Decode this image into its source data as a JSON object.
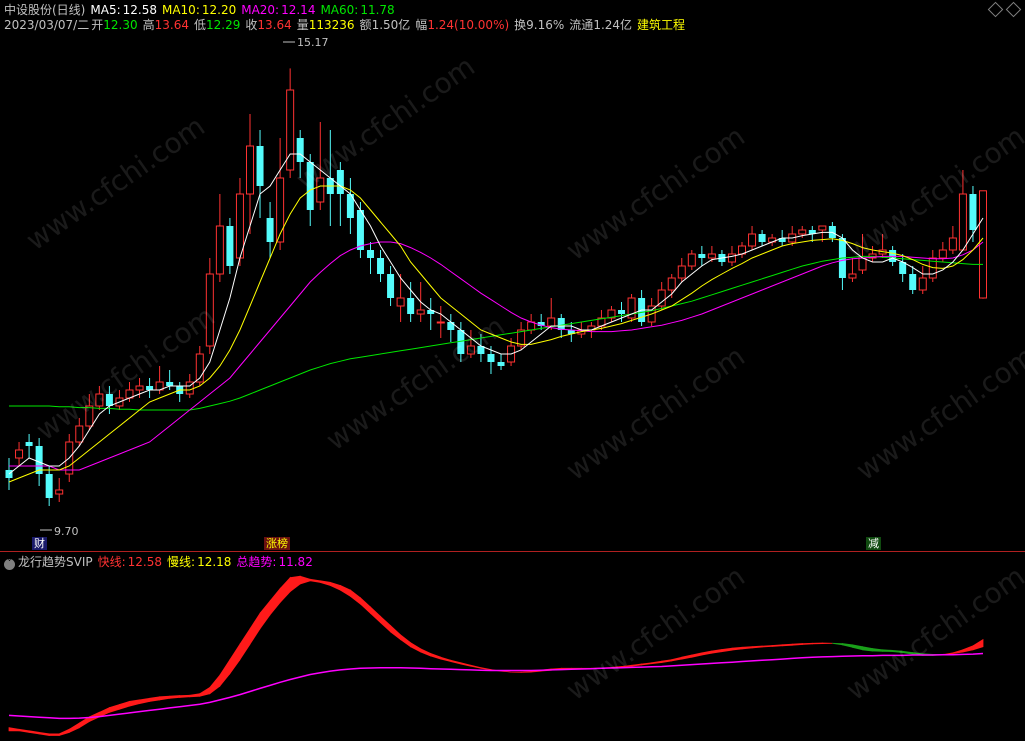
{
  "header": {
    "title": "中设股份(日线)",
    "ma5_label": "MA5:",
    "ma5": "12.58",
    "ma10_label": "MA10:",
    "ma10": "12.20",
    "ma20_label": "MA20:",
    "ma20": "12.14",
    "ma60_label": "MA60:",
    "ma60": "11.78",
    "date": "2023/03/07/二",
    "open_label": "开",
    "open": "12.30",
    "high_label": "高",
    "high": "13.64",
    "low_label": "低",
    "low": "12.29",
    "close_label": "收",
    "close": "13.64",
    "vol_label": "量",
    "vol": "113236",
    "amount_label": "额",
    "amount": "1.50亿",
    "change_label": "幅",
    "change": "1.24(10.00%)",
    "turnover_label": "换",
    "turnover": "9.16%",
    "float_label": "流通",
    "float": "1.24亿",
    "sector": "建筑工程"
  },
  "markers": {
    "high": "15.17",
    "low": "9.70",
    "tag_cai": "财",
    "tag_zhangbang": "涨榜",
    "tag_jian": "减"
  },
  "indicator": {
    "name": "龙行趋势SVIP",
    "fast_label": "快线:",
    "fast": "12.58",
    "slow_label": "慢线:",
    "slow": "12.18",
    "total_label": "总趋势:",
    "total": "11.82"
  },
  "watermark": "www.cfchi.com",
  "colors": {
    "up": "#ff3232",
    "down": "#54fcfc",
    "ma5": "#ffffff",
    "ma10": "#ffff00",
    "ma20": "#ff00ff",
    "ma60": "#00e600",
    "frame": "#b02020"
  },
  "chart_data": {
    "type": "candlestick",
    "ylim": [
      9.4,
      15.5
    ],
    "candles": [
      {
        "o": 10.15,
        "c": 10.05,
        "h": 10.3,
        "l": 9.9
      },
      {
        "o": 10.3,
        "c": 10.4,
        "h": 10.5,
        "l": 10.2
      },
      {
        "o": 10.5,
        "c": 10.45,
        "h": 10.6,
        "l": 10.3
      },
      {
        "o": 10.45,
        "c": 10.1,
        "h": 10.55,
        "l": 9.95
      },
      {
        "o": 10.1,
        "c": 9.8,
        "h": 10.2,
        "l": 9.7
      },
      {
        "o": 9.85,
        "c": 9.9,
        "h": 10.05,
        "l": 9.75
      },
      {
        "o": 10.1,
        "c": 10.5,
        "h": 10.6,
        "l": 10.0
      },
      {
        "o": 10.5,
        "c": 10.7,
        "h": 10.8,
        "l": 10.45
      },
      {
        "o": 10.7,
        "c": 10.95,
        "h": 11.1,
        "l": 10.65
      },
      {
        "o": 10.95,
        "c": 11.1,
        "h": 11.2,
        "l": 10.9
      },
      {
        "o": 11.1,
        "c": 10.95,
        "h": 11.2,
        "l": 10.85
      },
      {
        "o": 10.95,
        "c": 11.05,
        "h": 11.15,
        "l": 10.9
      },
      {
        "o": 11.05,
        "c": 11.15,
        "h": 11.25,
        "l": 11.0
      },
      {
        "o": 11.15,
        "c": 11.2,
        "h": 11.3,
        "l": 11.05
      },
      {
        "o": 11.2,
        "c": 11.15,
        "h": 11.3,
        "l": 11.05
      },
      {
        "o": 11.15,
        "c": 11.25,
        "h": 11.45,
        "l": 11.1
      },
      {
        "o": 11.25,
        "c": 11.2,
        "h": 11.4,
        "l": 11.15
      },
      {
        "o": 11.2,
        "c": 11.1,
        "h": 11.25,
        "l": 11.0
      },
      {
        "o": 11.1,
        "c": 11.25,
        "h": 11.35,
        "l": 11.05
      },
      {
        "o": 11.25,
        "c": 11.6,
        "h": 11.7,
        "l": 11.2
      },
      {
        "o": 11.7,
        "c": 12.6,
        "h": 12.8,
        "l": 11.6
      },
      {
        "o": 12.6,
        "c": 13.2,
        "h": 13.6,
        "l": 12.5
      },
      {
        "o": 13.2,
        "c": 12.7,
        "h": 13.3,
        "l": 12.6
      },
      {
        "o": 12.8,
        "c": 13.6,
        "h": 13.8,
        "l": 12.7
      },
      {
        "o": 13.6,
        "c": 14.2,
        "h": 14.6,
        "l": 13.1
      },
      {
        "o": 14.2,
        "c": 13.7,
        "h": 14.4,
        "l": 13.3
      },
      {
        "o": 13.3,
        "c": 13.0,
        "h": 13.5,
        "l": 12.8
      },
      {
        "o": 13.0,
        "c": 13.8,
        "h": 14.3,
        "l": 12.9
      },
      {
        "o": 13.9,
        "c": 14.9,
        "h": 15.17,
        "l": 13.8
      },
      {
        "o": 14.3,
        "c": 14.0,
        "h": 14.4,
        "l": 13.8
      },
      {
        "o": 14.0,
        "c": 13.4,
        "h": 14.1,
        "l": 13.2
      },
      {
        "o": 13.5,
        "c": 13.8,
        "h": 14.5,
        "l": 13.4
      },
      {
        "o": 13.8,
        "c": 13.6,
        "h": 14.4,
        "l": 13.2
      },
      {
        "o": 13.9,
        "c": 13.6,
        "h": 14.0,
        "l": 13.2
      },
      {
        "o": 13.6,
        "c": 13.3,
        "h": 13.8,
        "l": 13.1
      },
      {
        "o": 13.4,
        "c": 12.9,
        "h": 13.5,
        "l": 12.8
      },
      {
        "o": 12.9,
        "c": 12.8,
        "h": 13.0,
        "l": 12.6
      },
      {
        "o": 12.8,
        "c": 12.6,
        "h": 12.9,
        "l": 12.5
      },
      {
        "o": 12.6,
        "c": 12.3,
        "h": 12.7,
        "l": 12.2
      },
      {
        "o": 12.2,
        "c": 12.3,
        "h": 12.6,
        "l": 12.0
      },
      {
        "o": 12.3,
        "c": 12.1,
        "h": 12.5,
        "l": 12.0
      },
      {
        "o": 12.1,
        "c": 12.15,
        "h": 12.5,
        "l": 12.0
      },
      {
        "o": 12.15,
        "c": 12.1,
        "h": 12.3,
        "l": 11.9
      },
      {
        "o": 12.0,
        "c": 12.0,
        "h": 12.2,
        "l": 11.8
      },
      {
        "o": 12.0,
        "c": 11.9,
        "h": 12.1,
        "l": 11.75
      },
      {
        "o": 11.9,
        "c": 11.6,
        "h": 12.0,
        "l": 11.5
      },
      {
        "o": 11.6,
        "c": 11.7,
        "h": 11.9,
        "l": 11.55
      },
      {
        "o": 11.7,
        "c": 11.6,
        "h": 11.85,
        "l": 11.5
      },
      {
        "o": 11.6,
        "c": 11.5,
        "h": 11.7,
        "l": 11.35
      },
      {
        "o": 11.5,
        "c": 11.45,
        "h": 11.6,
        "l": 11.4
      },
      {
        "o": 11.5,
        "c": 11.7,
        "h": 11.8,
        "l": 11.45
      },
      {
        "o": 11.7,
        "c": 11.9,
        "h": 12.0,
        "l": 11.65
      },
      {
        "o": 11.9,
        "c": 12.0,
        "h": 12.1,
        "l": 11.85
      },
      {
        "o": 12.0,
        "c": 11.95,
        "h": 12.1,
        "l": 11.9
      },
      {
        "o": 11.95,
        "c": 12.05,
        "h": 12.3,
        "l": 11.9
      },
      {
        "o": 12.05,
        "c": 11.9,
        "h": 12.1,
        "l": 11.8
      },
      {
        "o": 11.9,
        "c": 11.85,
        "h": 12.0,
        "l": 11.75
      },
      {
        "o": 11.85,
        "c": 11.9,
        "h": 12.0,
        "l": 11.8
      },
      {
        "o": 11.9,
        "c": 11.95,
        "h": 12.0,
        "l": 11.8
      },
      {
        "o": 11.95,
        "c": 12.05,
        "h": 12.15,
        "l": 11.9
      },
      {
        "o": 12.05,
        "c": 12.15,
        "h": 12.2,
        "l": 12.0
      },
      {
        "o": 12.15,
        "c": 12.1,
        "h": 12.25,
        "l": 12.0
      },
      {
        "o": 12.05,
        "c": 12.3,
        "h": 12.35,
        "l": 12.0
      },
      {
        "o": 12.3,
        "c": 12.0,
        "h": 12.4,
        "l": 11.95
      },
      {
        "o": 12.0,
        "c": 12.2,
        "h": 12.3,
        "l": 11.95
      },
      {
        "o": 12.2,
        "c": 12.4,
        "h": 12.5,
        "l": 12.15
      },
      {
        "o": 12.4,
        "c": 12.55,
        "h": 12.6,
        "l": 12.3
      },
      {
        "o": 12.55,
        "c": 12.7,
        "h": 12.8,
        "l": 12.5
      },
      {
        "o": 12.7,
        "c": 12.85,
        "h": 12.9,
        "l": 12.65
      },
      {
        "o": 12.85,
        "c": 12.8,
        "h": 12.95,
        "l": 12.7
      },
      {
        "o": 12.8,
        "c": 12.85,
        "h": 12.95,
        "l": 12.75
      },
      {
        "o": 12.85,
        "c": 12.75,
        "h": 12.9,
        "l": 12.7
      },
      {
        "o": 12.75,
        "c": 12.85,
        "h": 12.95,
        "l": 12.7
      },
      {
        "o": 12.85,
        "c": 12.95,
        "h": 13.0,
        "l": 12.8
      },
      {
        "o": 12.95,
        "c": 13.1,
        "h": 13.2,
        "l": 12.9
      },
      {
        "o": 13.1,
        "c": 13.0,
        "h": 13.15,
        "l": 12.95
      },
      {
        "o": 13.0,
        "c": 13.05,
        "h": 13.1,
        "l": 12.95
      },
      {
        "o": 13.05,
        "c": 13.0,
        "h": 13.15,
        "l": 12.95
      },
      {
        "o": 13.0,
        "c": 13.1,
        "h": 13.2,
        "l": 12.95
      },
      {
        "o": 13.1,
        "c": 13.15,
        "h": 13.2,
        "l": 13.05
      },
      {
        "o": 13.15,
        "c": 13.1,
        "h": 13.2,
        "l": 13.0
      },
      {
        "o": 13.15,
        "c": 13.2,
        "h": 13.2,
        "l": 13.0
      },
      {
        "o": 13.2,
        "c": 13.05,
        "h": 13.25,
        "l": 13.0
      },
      {
        "o": 13.05,
        "c": 12.55,
        "h": 13.1,
        "l": 12.4
      },
      {
        "o": 12.55,
        "c": 12.6,
        "h": 12.8,
        "l": 12.5
      },
      {
        "o": 12.65,
        "c": 12.8,
        "h": 13.1,
        "l": 12.6
      },
      {
        "o": 12.8,
        "c": 12.85,
        "h": 12.95,
        "l": 12.75
      },
      {
        "o": 12.85,
        "c": 12.9,
        "h": 13.1,
        "l": 12.8
      },
      {
        "o": 12.9,
        "c": 12.75,
        "h": 12.95,
        "l": 12.7
      },
      {
        "o": 12.75,
        "c": 12.6,
        "h": 12.85,
        "l": 12.5
      },
      {
        "o": 12.6,
        "c": 12.4,
        "h": 12.7,
        "l": 12.35
      },
      {
        "o": 12.4,
        "c": 12.55,
        "h": 12.7,
        "l": 12.35
      },
      {
        "o": 12.55,
        "c": 12.8,
        "h": 12.9,
        "l": 12.5
      },
      {
        "o": 12.8,
        "c": 12.9,
        "h": 13.0,
        "l": 12.75
      },
      {
        "o": 12.9,
        "c": 13.05,
        "h": 13.2,
        "l": 12.85
      },
      {
        "o": 12.9,
        "c": 13.6,
        "h": 13.9,
        "l": 12.9
      },
      {
        "o": 13.6,
        "c": 13.15,
        "h": 13.7,
        "l": 13.0
      },
      {
        "o": 12.3,
        "c": 13.64,
        "h": 13.64,
        "l": 12.29
      }
    ],
    "ma5": [
      10.1,
      10.2,
      10.3,
      10.25,
      10.2,
      10.2,
      10.3,
      10.45,
      10.65,
      10.85,
      10.95,
      11.0,
      11.05,
      11.1,
      11.15,
      11.15,
      11.2,
      11.2,
      11.2,
      11.3,
      11.5,
      11.9,
      12.3,
      12.8,
      13.2,
      13.6,
      13.7,
      13.9,
      14.1,
      14.1,
      14.0,
      13.9,
      13.8,
      13.7,
      13.6,
      13.4,
      13.2,
      12.95,
      12.75,
      12.55,
      12.4,
      12.25,
      12.15,
      12.1,
      12.0,
      11.9,
      11.8,
      11.7,
      11.65,
      11.6,
      11.6,
      11.65,
      11.75,
      11.85,
      11.95,
      11.95,
      11.95,
      11.9,
      11.9,
      11.95,
      12.0,
      12.05,
      12.1,
      12.15,
      12.15,
      12.25,
      12.35,
      12.5,
      12.6,
      12.7,
      12.78,
      12.8,
      12.82,
      12.85,
      12.9,
      12.95,
      13.0,
      13.05,
      13.05,
      13.08,
      13.1,
      13.12,
      13.12,
      13.05,
      12.9,
      12.8,
      12.75,
      12.75,
      12.8,
      12.75,
      12.68,
      12.6,
      12.6,
      12.65,
      12.75,
      12.9,
      13.1,
      13.3
    ],
    "ma10": [
      10.0,
      10.05,
      10.1,
      10.15,
      10.15,
      10.15,
      10.2,
      10.3,
      10.4,
      10.5,
      10.6,
      10.7,
      10.8,
      10.9,
      11.0,
      11.05,
      11.1,
      11.15,
      11.15,
      11.2,
      11.3,
      11.45,
      11.65,
      11.9,
      12.2,
      12.5,
      12.8,
      13.1,
      13.35,
      13.55,
      13.65,
      13.7,
      13.7,
      13.7,
      13.65,
      13.55,
      13.4,
      13.25,
      13.1,
      12.95,
      12.75,
      12.6,
      12.45,
      12.3,
      12.2,
      12.1,
      12.0,
      11.9,
      11.85,
      11.8,
      11.75,
      11.72,
      11.72,
      11.75,
      11.78,
      11.82,
      11.85,
      11.88,
      11.9,
      11.92,
      11.95,
      11.98,
      12.02,
      12.06,
      12.1,
      12.15,
      12.2,
      12.28,
      12.36,
      12.45,
      12.53,
      12.6,
      12.67,
      12.73,
      12.8,
      12.85,
      12.9,
      12.95,
      12.98,
      13.0,
      13.02,
      13.03,
      13.04,
      13.02,
      12.98,
      12.93,
      12.9,
      12.88,
      12.86,
      12.83,
      12.78,
      12.72,
      12.68,
      12.67,
      12.7,
      12.78,
      12.9,
      13.05
    ],
    "ma20": [
      10.2,
      10.2,
      10.2,
      10.2,
      10.2,
      10.15,
      10.15,
      10.15,
      10.2,
      10.25,
      10.3,
      10.35,
      10.4,
      10.45,
      10.5,
      10.6,
      10.7,
      10.8,
      10.9,
      11.0,
      11.1,
      11.2,
      11.3,
      11.45,
      11.6,
      11.75,
      11.9,
      12.05,
      12.2,
      12.35,
      12.5,
      12.62,
      12.73,
      12.83,
      12.9,
      12.95,
      12.98,
      13.0,
      13.0,
      12.98,
      12.93,
      12.87,
      12.8,
      12.72,
      12.63,
      12.54,
      12.45,
      12.36,
      12.28,
      12.2,
      12.12,
      12.05,
      12.0,
      11.96,
      11.93,
      11.91,
      11.9,
      11.89,
      11.88,
      11.88,
      11.88,
      11.89,
      11.9,
      11.92,
      11.94,
      11.96,
      11.99,
      12.02,
      12.06,
      12.1,
      12.15,
      12.2,
      12.25,
      12.3,
      12.35,
      12.4,
      12.45,
      12.5,
      12.55,
      12.6,
      12.65,
      12.7,
      12.74,
      12.77,
      12.79,
      12.8,
      12.81,
      12.82,
      12.82,
      12.82,
      12.81,
      12.8,
      12.79,
      12.79,
      12.8,
      12.84,
      12.9,
      13.0
    ],
    "ma60": [
      10.95,
      10.95,
      10.95,
      10.95,
      10.95,
      10.94,
      10.94,
      10.93,
      10.93,
      10.92,
      10.92,
      10.91,
      10.91,
      10.9,
      10.9,
      10.9,
      10.9,
      10.9,
      10.9,
      10.92,
      10.95,
      10.98,
      11.01,
      11.05,
      11.1,
      11.15,
      11.2,
      11.25,
      11.3,
      11.35,
      11.4,
      11.44,
      11.48,
      11.51,
      11.54,
      11.56,
      11.58,
      11.6,
      11.62,
      11.64,
      11.66,
      11.68,
      11.7,
      11.72,
      11.74,
      11.76,
      11.78,
      11.8,
      11.82,
      11.84,
      11.86,
      11.88,
      11.9,
      11.92,
      11.94,
      11.96,
      11.98,
      12.0,
      12.02,
      12.04,
      12.06,
      12.08,
      12.1,
      12.12,
      12.14,
      12.17,
      12.2,
      12.23,
      12.26,
      12.3,
      12.34,
      12.38,
      12.42,
      12.46,
      12.5,
      12.54,
      12.58,
      12.62,
      12.66,
      12.7,
      12.73,
      12.76,
      12.78,
      12.8,
      12.81,
      12.82,
      12.82,
      12.81,
      12.8,
      12.79,
      12.78,
      12.77,
      12.76,
      12.75,
      12.74,
      12.73,
      12.72,
      12.72
    ]
  },
  "indicator_data": {
    "ylim": [
      9.8,
      15.2
    ],
    "fast": [
      10.1,
      10.05,
      10.0,
      9.95,
      9.9,
      9.9,
      10.05,
      10.25,
      10.45,
      10.6,
      10.75,
      10.85,
      10.95,
      11.0,
      11.05,
      11.1,
      11.12,
      11.14,
      11.15,
      11.2,
      11.4,
      11.8,
      12.3,
      12.8,
      13.3,
      13.8,
      14.2,
      14.6,
      14.95,
      15.0,
      14.9,
      14.85,
      14.8,
      14.7,
      14.55,
      14.3,
      14.0,
      13.7,
      13.4,
      13.1,
      12.85,
      12.65,
      12.5,
      12.38,
      12.28,
      12.2,
      12.12,
      12.04,
      11.98,
      11.93,
      11.9,
      11.9,
      11.92,
      11.96,
      12.0,
      12.02,
      12.02,
      12.02,
      12.02,
      12.03,
      12.05,
      12.08,
      12.12,
      12.16,
      12.2,
      12.25,
      12.3,
      12.38,
      12.45,
      12.52,
      12.58,
      12.63,
      12.67,
      12.7,
      12.72,
      12.74,
      12.76,
      12.78,
      12.8,
      12.82,
      12.83,
      12.84,
      12.83,
      12.78,
      12.7,
      12.62,
      12.58,
      12.57,
      12.56,
      12.53,
      12.48,
      12.44,
      12.44,
      12.46,
      12.52,
      12.62,
      12.75,
      12.95
    ],
    "slow": [
      10.0,
      10.0,
      9.95,
      9.9,
      9.85,
      9.85,
      9.95,
      10.1,
      10.3,
      10.45,
      10.6,
      10.7,
      10.8,
      10.88,
      10.95,
      11.0,
      11.05,
      11.08,
      11.1,
      11.12,
      11.2,
      11.45,
      11.85,
      12.3,
      12.8,
      13.3,
      13.75,
      14.15,
      14.5,
      14.75,
      14.85,
      14.8,
      14.7,
      14.55,
      14.35,
      14.1,
      13.8,
      13.5,
      13.2,
      12.95,
      12.72,
      12.55,
      12.42,
      12.32,
      12.24,
      12.16,
      12.09,
      12.02,
      11.97,
      11.93,
      11.9,
      11.89,
      11.9,
      11.93,
      11.96,
      11.99,
      12.0,
      12.01,
      12.01,
      12.02,
      12.03,
      12.06,
      12.09,
      12.13,
      12.17,
      12.21,
      12.26,
      12.32,
      12.38,
      12.45,
      12.51,
      12.56,
      12.61,
      12.65,
      12.68,
      12.71,
      12.73,
      12.75,
      12.77,
      12.79,
      12.81,
      12.82,
      12.83,
      12.82,
      12.78,
      12.72,
      12.66,
      12.62,
      12.6,
      12.57,
      12.53,
      12.49,
      12.47,
      12.47,
      12.5,
      12.55,
      12.62,
      12.72
    ],
    "total": [
      10.5,
      10.48,
      10.46,
      10.44,
      10.42,
      10.4,
      10.4,
      10.41,
      10.43,
      10.46,
      10.5,
      10.54,
      10.58,
      10.62,
      10.66,
      10.7,
      10.74,
      10.78,
      10.82,
      10.86,
      10.92,
      11.0,
      11.08,
      11.17,
      11.27,
      11.37,
      11.47,
      11.57,
      11.66,
      11.74,
      11.82,
      11.88,
      11.93,
      11.97,
      12.0,
      12.02,
      12.03,
      12.04,
      12.04,
      12.04,
      12.03,
      12.02,
      12.01,
      12.0,
      11.99,
      11.98,
      11.97,
      11.96,
      11.95,
      11.95,
      11.95,
      11.95,
      11.95,
      11.96,
      11.97,
      11.98,
      11.99,
      12.0,
      12.01,
      12.02,
      12.03,
      12.04,
      12.05,
      12.06,
      12.07,
      12.08,
      12.1,
      12.12,
      12.14,
      12.16,
      12.18,
      12.2,
      12.22,
      12.24,
      12.26,
      12.28,
      12.3,
      12.32,
      12.34,
      12.36,
      12.38,
      12.39,
      12.4,
      12.41,
      12.42,
      12.43,
      12.43,
      12.44,
      12.44,
      12.44,
      12.45,
      12.45,
      12.45,
      12.46,
      12.46,
      12.47,
      12.48,
      12.5
    ]
  }
}
